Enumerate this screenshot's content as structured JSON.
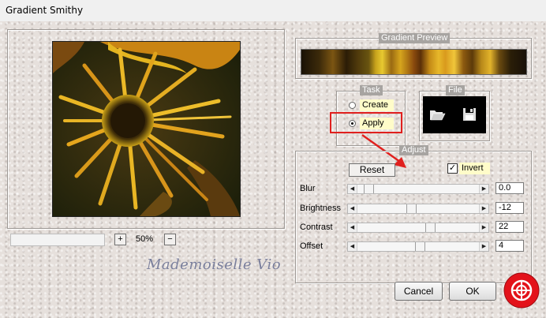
{
  "window": {
    "title": "Gradient Smithy"
  },
  "zoom": {
    "plus": "+",
    "value": "50%",
    "minus": "−"
  },
  "watermark": "Mademoiselle Vio",
  "gradient_preview": {
    "legend": "Gradient Preview"
  },
  "task": {
    "legend": "Task",
    "options": [
      {
        "label": "Create",
        "selected": false
      },
      {
        "label": "Apply",
        "selected": true
      }
    ]
  },
  "file": {
    "legend": "File",
    "open_icon": "folder-open-icon",
    "save_icon": "floppy-disk-icon"
  },
  "adjust": {
    "legend": "Adjust",
    "reset_label": "Reset",
    "invert_label": "Invert",
    "invert_checked": true,
    "sliders": [
      {
        "label": "Blur",
        "value": "0.0",
        "position": 0.06
      },
      {
        "label": "Brightness",
        "value": "-12",
        "position": 0.44
      },
      {
        "label": "Contrast",
        "value": "22",
        "position": 0.61
      },
      {
        "label": "Offset",
        "value": "4",
        "position": 0.52
      }
    ]
  },
  "buttons": {
    "cancel": "Cancel",
    "ok": "OK"
  },
  "colors": {
    "annotation": "#e0201e",
    "highlight": "#fffcc9",
    "preset_badge": "#e3121a"
  }
}
